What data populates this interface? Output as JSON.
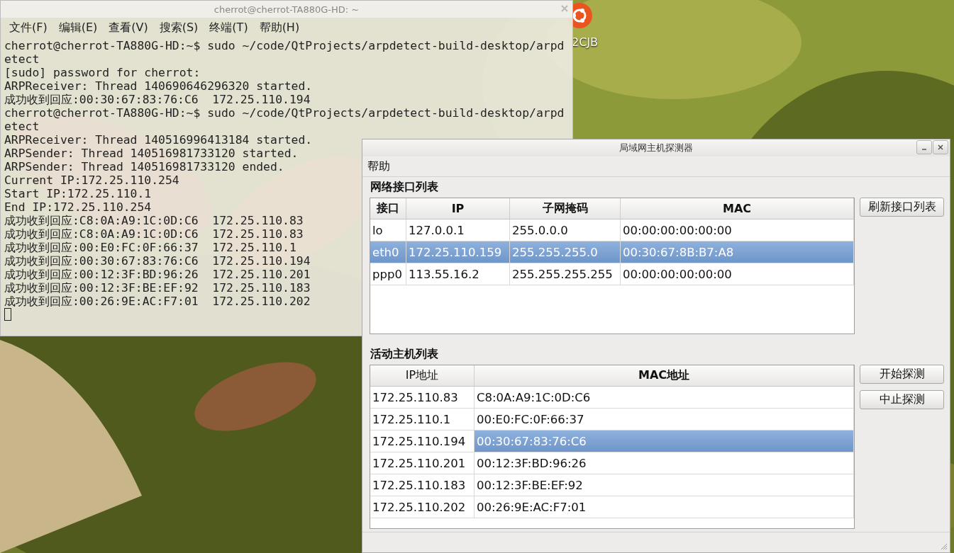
{
  "desktop": {
    "icon_labels": [
      "2CJB"
    ]
  },
  "terminal": {
    "title": "cherrot@cherrot-TA880G-HD: ~",
    "menu": [
      "文件(F)",
      "编辑(E)",
      "查看(V)",
      "搜索(S)",
      "终端(T)",
      "帮助(H)"
    ],
    "lines": [
      "cherrot@cherrot-TA880G-HD:~$ sudo ~/code/QtProjects/arpdetect-build-desktop/arpd",
      "etect",
      "[sudo] password for cherrot:",
      "ARPReceiver: Thread 140690646296320 started.",
      "成功收到回应:00:30:67:83:76:C6  172.25.110.194",
      "cherrot@cherrot-TA880G-HD:~$ sudo ~/code/QtProjects/arpdetect-build-desktop/arpd",
      "etect",
      "ARPReceiver: Thread 140516996413184 started.",
      "ARPSender: Thread 140516981733120 started.",
      "ARPSender: Thread 140516981733120 ended.",
      "Current IP:172.25.110.254",
      "Start IP:172.25.110.1",
      "End IP:172.25.110.254",
      "成功收到回应:C8:0A:A9:1C:0D:C6  172.25.110.83",
      "成功收到回应:C8:0A:A9:1C:0D:C6  172.25.110.83",
      "成功收到回应:00:E0:FC:0F:66:37  172.25.110.1",
      "成功收到回应:00:30:67:83:76:C6  172.25.110.194",
      "成功收到回应:00:12:3F:BD:96:26  172.25.110.201",
      "成功收到回应:00:12:3F:BE:EF:92  172.25.110.183",
      "成功收到回应:00:26:9E:AC:F7:01  172.25.110.202"
    ]
  },
  "dialog": {
    "title": "局域网主机探测器",
    "menu": [
      "帮助"
    ],
    "interfaces": {
      "label": "网络接口列表",
      "columns": [
        {
          "label": "接口",
          "bold": true
        },
        {
          "label": "IP",
          "bold": true
        },
        {
          "label": "子网掩码",
          "bold": true
        },
        {
          "label": "MAC",
          "bold": true
        }
      ],
      "rows": [
        {
          "cells": [
            {
              "text": "lo",
              "selected": false
            },
            {
              "text": "127.0.0.1",
              "selected": false
            },
            {
              "text": "255.0.0.0",
              "selected": false
            },
            {
              "text": "00:00:00:00:00:00",
              "selected": false
            }
          ]
        },
        {
          "cells": [
            {
              "text": "eth0",
              "selected": true
            },
            {
              "text": "172.25.110.159",
              "selected": true
            },
            {
              "text": "255.255.255.0",
              "selected": true
            },
            {
              "text": "00:30:67:8B:B7:A8",
              "selected": true
            }
          ]
        },
        {
          "cells": [
            {
              "text": "ppp0",
              "selected": false
            },
            {
              "text": "113.55.16.2",
              "selected": false
            },
            {
              "text": "255.255.255.255",
              "selected": false
            },
            {
              "text": "00:00:00:00:00:00",
              "selected": false
            }
          ]
        }
      ],
      "buttons": [
        "刷新接口列表"
      ]
    },
    "hosts": {
      "label": "活动主机列表",
      "columns": [
        {
          "label": "IP地址",
          "bold": false
        },
        {
          "label": "MAC地址",
          "bold": true
        }
      ],
      "rows": [
        {
          "cells": [
            {
              "text": "172.25.110.83",
              "selected": false
            },
            {
              "text": "C8:0A:A9:1C:0D:C6",
              "selected": false
            }
          ]
        },
        {
          "cells": [
            {
              "text": "172.25.110.1",
              "selected": false
            },
            {
              "text": "00:E0:FC:0F:66:37",
              "selected": false
            }
          ]
        },
        {
          "cells": [
            {
              "text": "172.25.110.194",
              "selected": false
            },
            {
              "text": "00:30:67:83:76:C6",
              "selected": true
            }
          ]
        },
        {
          "cells": [
            {
              "text": "172.25.110.201",
              "selected": false
            },
            {
              "text": "00:12:3F:BD:96:26",
              "selected": false
            }
          ]
        },
        {
          "cells": [
            {
              "text": "172.25.110.183",
              "selected": false
            },
            {
              "text": "00:12:3F:BE:EF:92",
              "selected": false
            }
          ]
        },
        {
          "cells": [
            {
              "text": "172.25.110.202",
              "selected": false
            },
            {
              "text": "00:26:9E:AC:F7:01",
              "selected": false
            }
          ]
        }
      ],
      "buttons": [
        "开始探测",
        "中止探测"
      ]
    }
  }
}
